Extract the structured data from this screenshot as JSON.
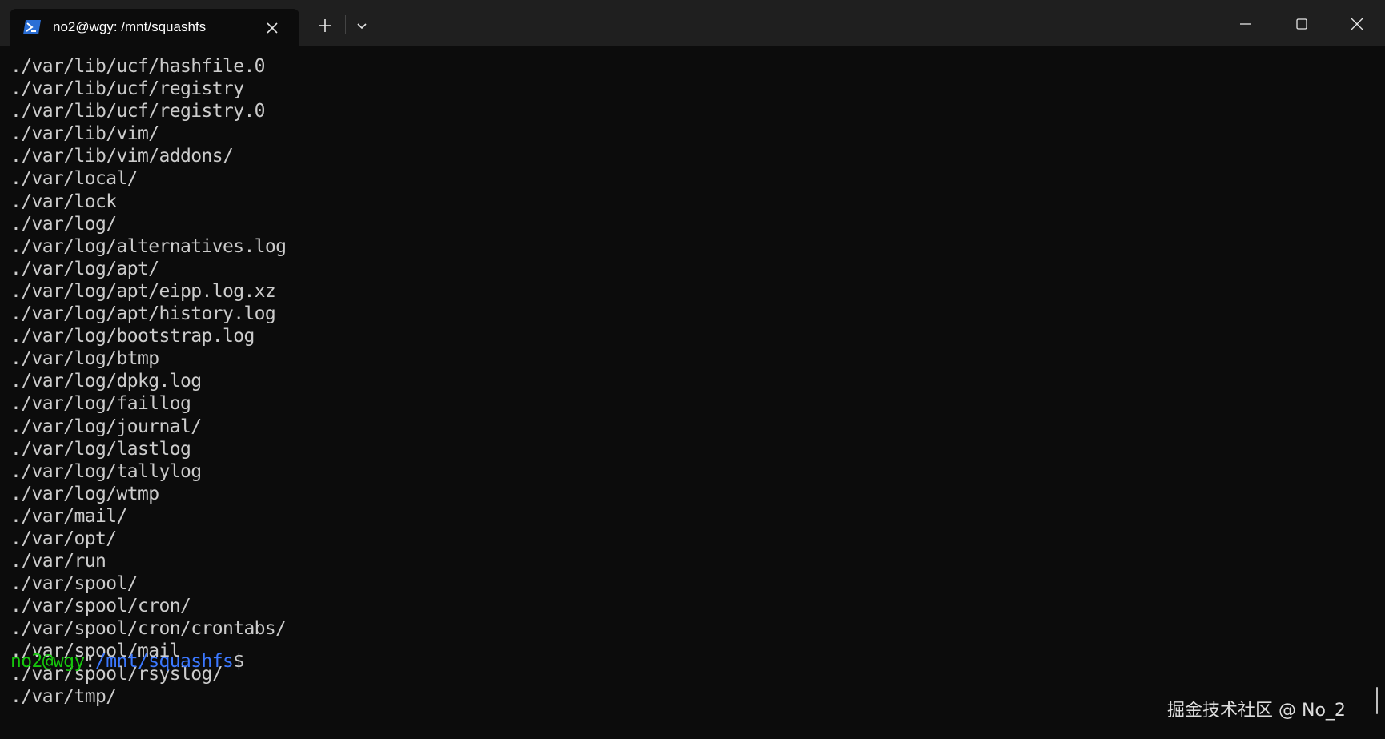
{
  "window": {
    "tab_title": "no2@wgy: /mnt/squashfs",
    "tab_icon": "powershell-icon",
    "new_tab_icon": "plus-icon",
    "dropdown_icon": "chevron-down-icon",
    "minimize_icon": "minimize-icon",
    "maximize_icon": "maximize-icon",
    "close_icon": "close-icon"
  },
  "terminal": {
    "background": "#0c0c0c",
    "text_color": "#cccccc",
    "lines": [
      "./var/lib/ucf/hashfile.0",
      "./var/lib/ucf/registry",
      "./var/lib/ucf/registry.0",
      "./var/lib/vim/",
      "./var/lib/vim/addons/",
      "./var/local/",
      "./var/lock",
      "./var/log/",
      "./var/log/alternatives.log",
      "./var/log/apt/",
      "./var/log/apt/eipp.log.xz",
      "./var/log/apt/history.log",
      "./var/log/bootstrap.log",
      "./var/log/btmp",
      "./var/log/dpkg.log",
      "./var/log/faillog",
      "./var/log/journal/",
      "./var/log/lastlog",
      "./var/log/tallylog",
      "./var/log/wtmp",
      "./var/mail/",
      "./var/opt/",
      "./var/run",
      "./var/spool/",
      "./var/spool/cron/",
      "./var/spool/cron/crontabs/",
      "./var/spool/mail",
      "./var/spool/rsyslog/",
      "./var/tmp/"
    ],
    "prompt": {
      "user_host": "no2@wgy",
      "colon": ":",
      "path": "/mnt/squashfs",
      "dollar": "$",
      "user_color": "#16c60c",
      "path_color": "#3b78ff"
    }
  },
  "watermark": "掘金技术社区 @ No_2"
}
